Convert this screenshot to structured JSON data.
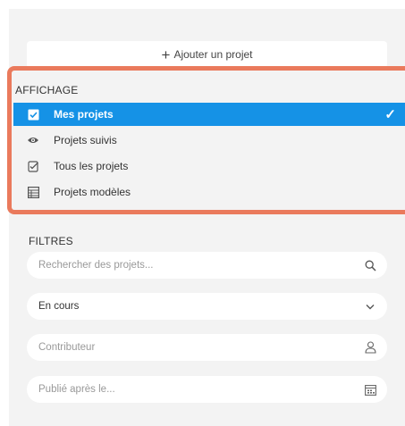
{
  "toolbar": {
    "add_project_label": "Ajouter un projet"
  },
  "views": {
    "title": "AFFICHAGE",
    "items": [
      {
        "label": "Mes projets",
        "icon": "checkbox-icon",
        "active": true
      },
      {
        "label": "Projets suivis",
        "icon": "eye-icon",
        "active": false
      },
      {
        "label": "Tous les projets",
        "icon": "checklist-icon",
        "active": false
      },
      {
        "label": "Projets modèles",
        "icon": "template-icon",
        "active": false
      }
    ]
  },
  "filters": {
    "title": "FILTRES",
    "search_placeholder": "Rechercher des projets...",
    "status_value": "En cours",
    "contributor_placeholder": "Contributeur",
    "published_after_placeholder": "Publié après le..."
  },
  "colors": {
    "accent": "#1592e6",
    "highlight_border": "#ea7a5c",
    "panel_bg": "#f3f3f3"
  }
}
